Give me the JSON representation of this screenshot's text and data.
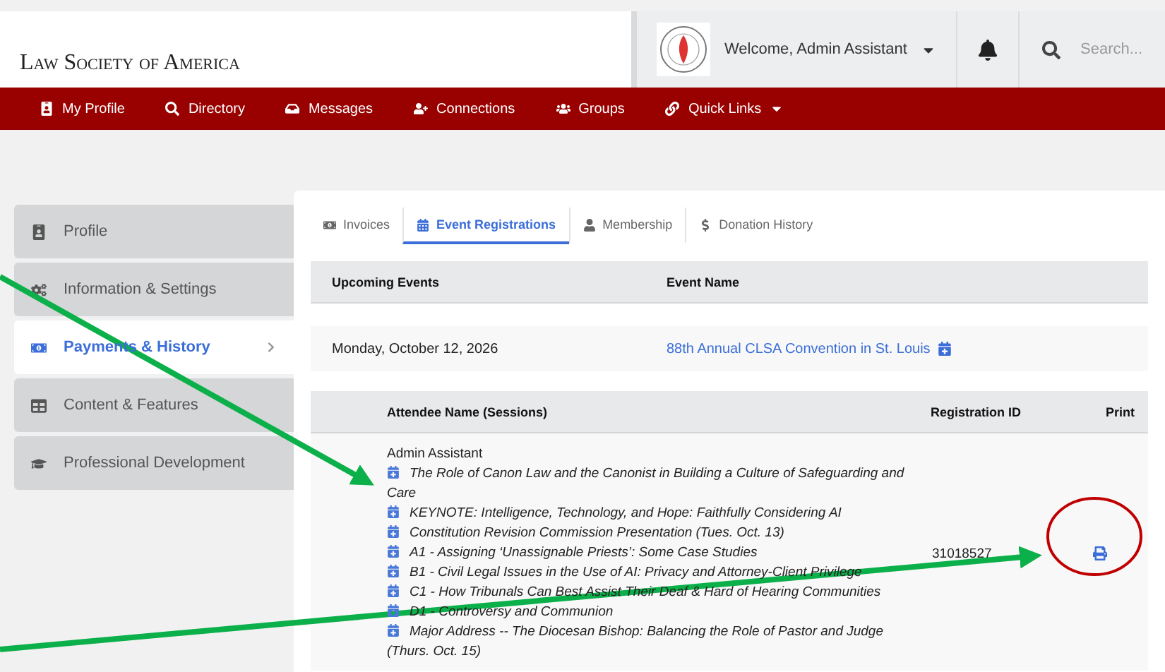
{
  "header": {
    "brand": "Law Society of America",
    "welcome": "Welcome, Admin Assistant",
    "search": {
      "placeholder": "Search..."
    }
  },
  "nav": [
    {
      "label": "My Profile",
      "kind": "profile"
    },
    {
      "label": "Directory",
      "kind": "search"
    },
    {
      "label": "Messages",
      "kind": "inbox"
    },
    {
      "label": "Connections",
      "kind": "connect"
    },
    {
      "label": "Groups",
      "kind": "groups"
    },
    {
      "label": "Quick Links",
      "kind": "links",
      "dropdown": true
    }
  ],
  "sidebar": {
    "items": [
      {
        "label": "Profile",
        "kind": "profile",
        "selected": false
      },
      {
        "label": "Information & Settings",
        "kind": "settings",
        "selected": false
      },
      {
        "label": "Payments & History",
        "kind": "payments",
        "selected": true
      },
      {
        "label": "Content & Features",
        "kind": "table",
        "selected": false
      },
      {
        "label": "Professional Development",
        "kind": "education",
        "selected": false
      }
    ]
  },
  "tabs": [
    {
      "label": "Invoices",
      "kind": "invoice",
      "selected": false
    },
    {
      "label": "Event Registrations",
      "kind": "calendar",
      "selected": true
    },
    {
      "label": "Membership",
      "kind": "user",
      "selected": false
    },
    {
      "label": "Donation History",
      "kind": "dollar",
      "selected": false
    }
  ],
  "events_table": {
    "columns": [
      "Upcoming Events",
      "Event Name"
    ],
    "rows": [
      {
        "date": "Monday, October 12, 2026",
        "event": "88th Annual CLSA Convention in St. Louis"
      }
    ]
  },
  "attendee_table": {
    "columns": [
      "Attendee Name (Sessions)",
      "Registration ID",
      "Print"
    ],
    "rows": [
      {
        "name": "Admin Assistant",
        "registration_id": "31018527",
        "sessions": [
          "The Role of Canon Law and the Canonist in Building a Culture of Safeguarding and Care",
          "KEYNOTE: Intelligence, Technology, and Hope: Faithfully Considering AI",
          "Constitution Revision Commission Presentation (Tues. Oct. 13)",
          "A1 - Assigning ‘Unassignable Priests’: Some Case Studies",
          "B1 - Civil Legal Issues in the Use of AI: Privacy and Attorney-Client Privilege",
          "C1 - How Tribunals Can Best Assist Their Deaf & Hard of Hearing Communities",
          "D1 - Controversy and Communion",
          "Major Address -- The Diocesan Bishop: Balancing the Role of Pastor and Judge (Thurs. Oct. 15)"
        ]
      }
    ]
  }
}
